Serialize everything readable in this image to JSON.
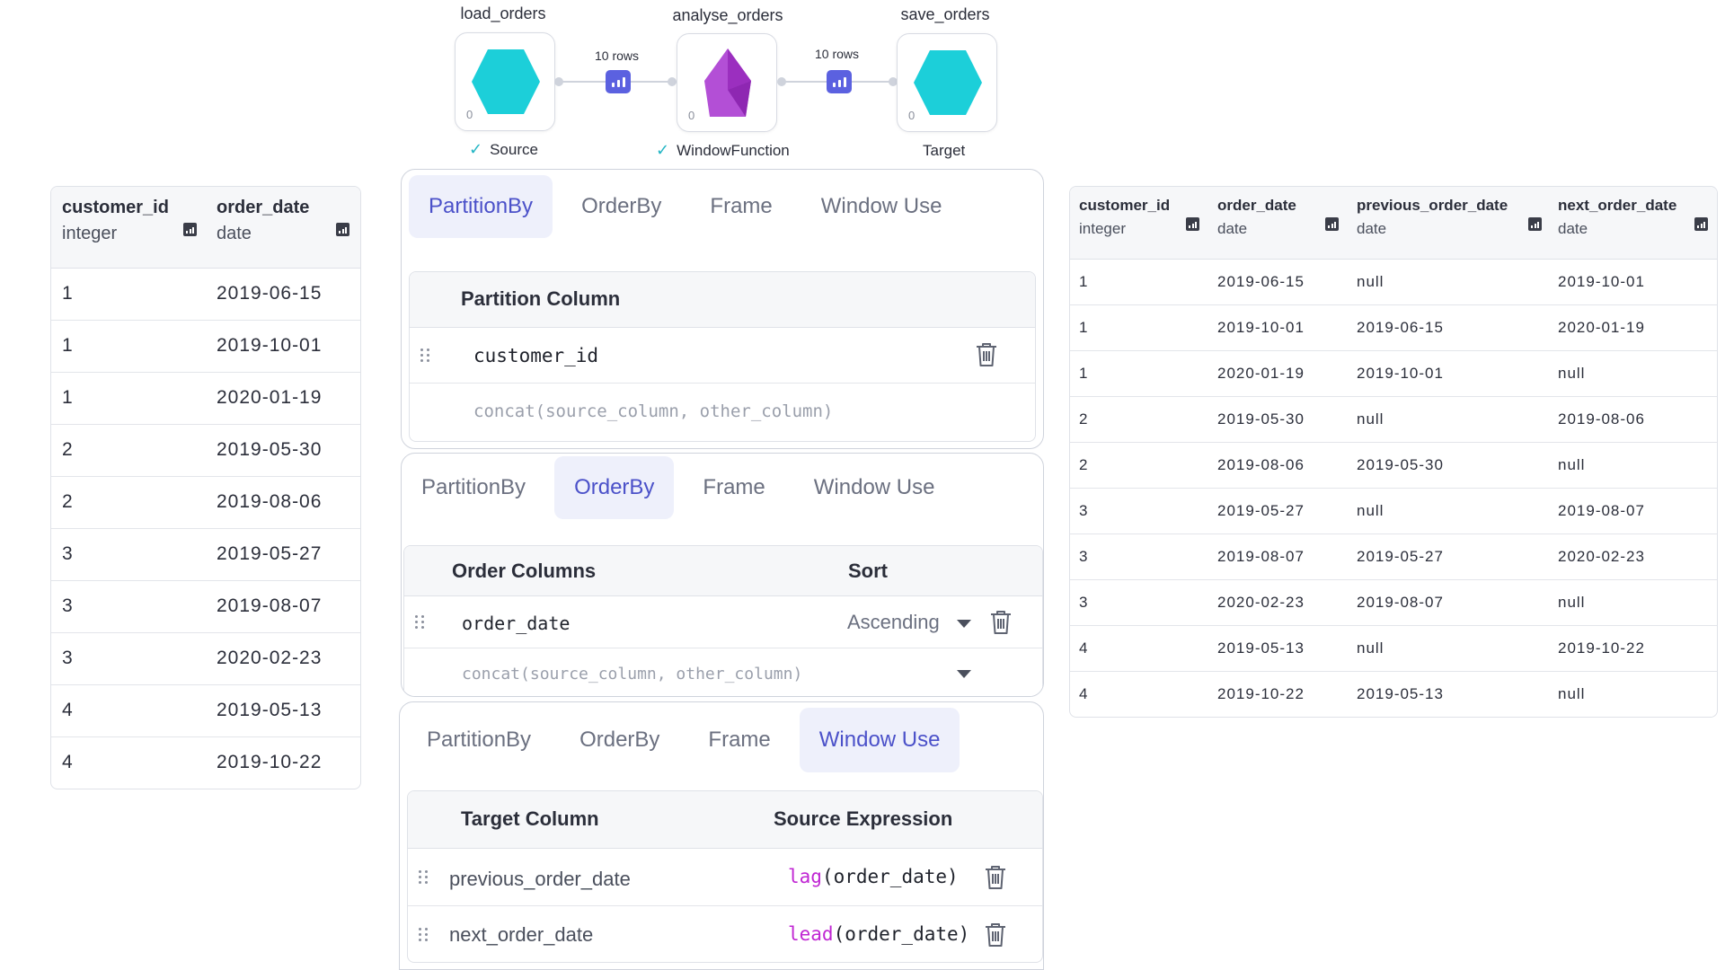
{
  "pipeline": {
    "nodes": [
      {
        "title": "load_orders",
        "label": "Source",
        "count": "0",
        "checked": true,
        "color": "#1ccfd9"
      },
      {
        "title": "analyse_orders",
        "label": "WindowFunction",
        "count": "0",
        "checked": true,
        "color": "#a63cc6"
      },
      {
        "title": "save_orders",
        "label": "Target",
        "count": "0",
        "checked": false,
        "color": "#1ccfd9"
      }
    ],
    "edges": [
      {
        "rows_label": "10 rows"
      },
      {
        "rows_label": "10 rows"
      }
    ]
  },
  "input_table": {
    "columns": [
      {
        "name": "customer_id",
        "type": "integer"
      },
      {
        "name": "order_date",
        "type": "date"
      }
    ],
    "rows": [
      [
        "1",
        "2019-06-15"
      ],
      [
        "1",
        "2019-10-01"
      ],
      [
        "1",
        "2020-01-19"
      ],
      [
        "2",
        "2019-05-30"
      ],
      [
        "2",
        "2019-08-06"
      ],
      [
        "3",
        "2019-05-27"
      ],
      [
        "3",
        "2019-08-07"
      ],
      [
        "3",
        "2020-02-23"
      ],
      [
        "4",
        "2019-05-13"
      ],
      [
        "4",
        "2019-10-22"
      ]
    ]
  },
  "output_table": {
    "columns": [
      {
        "name": "customer_id",
        "type": "integer"
      },
      {
        "name": "order_date",
        "type": "date"
      },
      {
        "name": "previous_order_date",
        "type": "date"
      },
      {
        "name": "next_order_date",
        "type": "date"
      }
    ],
    "rows": [
      [
        "1",
        "2019-06-15",
        "null",
        "2019-10-01"
      ],
      [
        "1",
        "2019-10-01",
        "2019-06-15",
        "2020-01-19"
      ],
      [
        "1",
        "2020-01-19",
        "2019-10-01",
        "null"
      ],
      [
        "2",
        "2019-05-30",
        "null",
        "2019-08-06"
      ],
      [
        "2",
        "2019-08-06",
        "2019-05-30",
        "null"
      ],
      [
        "3",
        "2019-05-27",
        "null",
        "2019-08-07"
      ],
      [
        "3",
        "2019-08-07",
        "2019-05-27",
        "2020-02-23"
      ],
      [
        "3",
        "2020-02-23",
        "2019-08-07",
        "null"
      ],
      [
        "4",
        "2019-05-13",
        "null",
        "2019-10-22"
      ],
      [
        "4",
        "2019-10-22",
        "2019-05-13",
        "null"
      ]
    ]
  },
  "tabs": [
    "PartitionBy",
    "OrderBy",
    "Frame",
    "Window Use"
  ],
  "partition_panel": {
    "active_tab": "PartitionBy",
    "header": "Partition Column",
    "column": "customer_id",
    "placeholder": "concat(source_column, other_column)"
  },
  "order_panel": {
    "active_tab": "OrderBy",
    "header_columns": "Order Columns",
    "header_sort": "Sort",
    "column": "order_date",
    "sort": "Ascending",
    "placeholder": "concat(source_column, other_column)"
  },
  "window_panel": {
    "active_tab": "Window Use",
    "header_target": "Target Column",
    "header_source": "Source Expression",
    "rows": [
      {
        "target": "previous_order_date",
        "fn": "lag",
        "arg": "(order_date)"
      },
      {
        "target": "next_order_date",
        "fn": "lead",
        "arg": "(order_date)"
      }
    ]
  }
}
